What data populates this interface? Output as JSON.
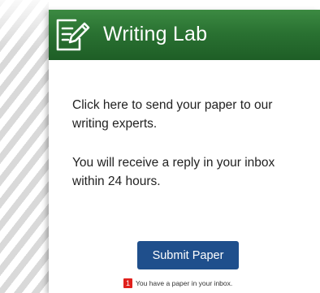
{
  "header": {
    "title": "Writing Lab",
    "icon": "writing-pad-pencil-icon",
    "color": "#2a7232"
  },
  "main": {
    "instruction": "Click here to send your paper to our writing experts.",
    "reply_info": "You will receive a reply in your inbox within 24 hours."
  },
  "actions": {
    "submit_label": "Submit Paper",
    "submit_color": "#1f4f8c"
  },
  "notification": {
    "count": "1",
    "text": "You have a paper in your inbox.",
    "badge_color": "#e0201c"
  }
}
